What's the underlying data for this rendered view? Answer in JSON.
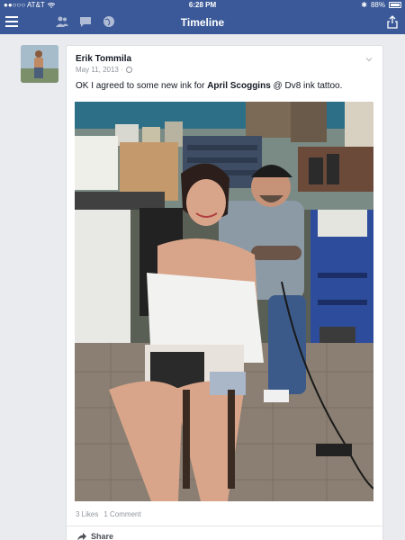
{
  "status_bar": {
    "carrier": "●●○○○ AT&T",
    "time": "6:28 PM",
    "bluetooth": "✱",
    "battery": "88%"
  },
  "nav": {
    "title": "Timeline",
    "icons": [
      "menu-icon",
      "friends-icon",
      "messages-icon",
      "globe-notifications-icon",
      "share-icon"
    ]
  },
  "post": {
    "author": "Erik Tommila",
    "date": "May 11, 2013 ·",
    "text_prefix": "OK I agreed to some new ink for ",
    "tagged_person": "April Scoggins",
    "text_middle": " @ ",
    "text_suffix": "Dv8 ink tattoo.",
    "likes": "3 Likes",
    "comments": "1 Comment",
    "share_label": "Share"
  },
  "colors": {
    "header": "#3b5998",
    "background": "#e9ebee",
    "meta_text": "#90949c"
  }
}
